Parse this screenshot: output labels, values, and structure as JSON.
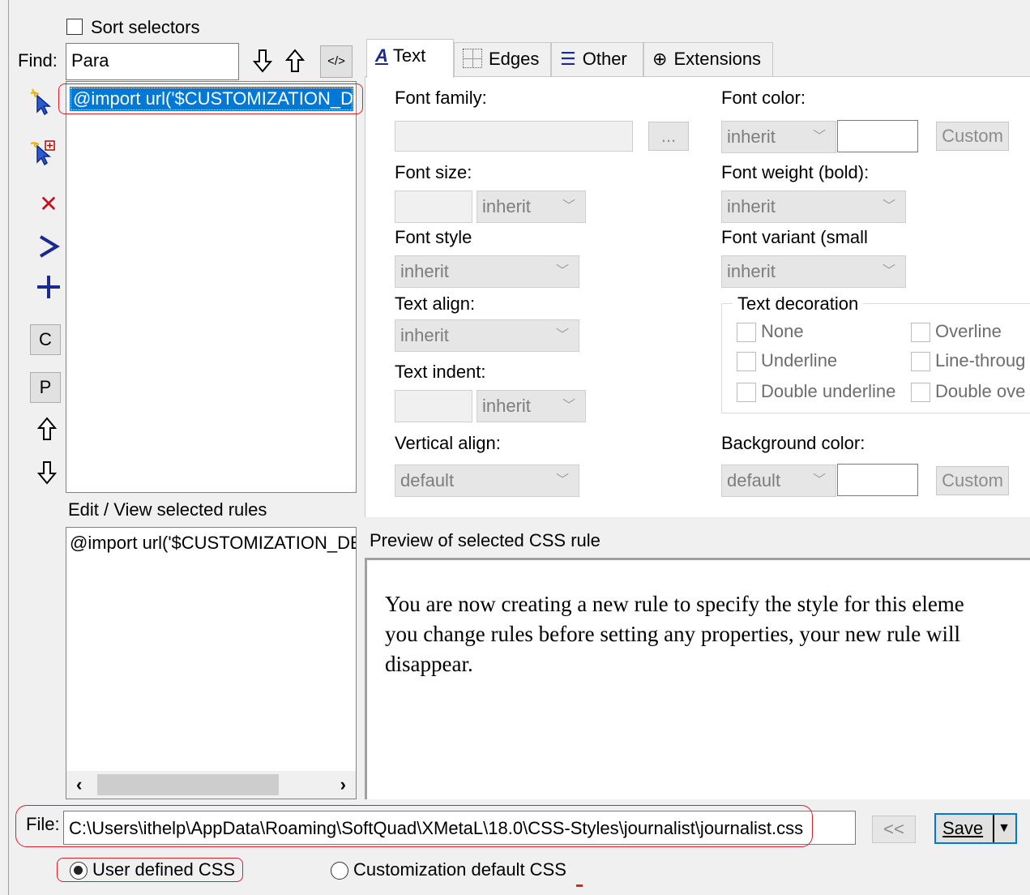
{
  "sort": {
    "label": "Sort selectors"
  },
  "find": {
    "label": "Find:",
    "value": "Para",
    "down_icon": "arrow-down-icon",
    "up_icon": "arrow-up-icon",
    "code_label": "</>"
  },
  "selectors": {
    "items": [
      "@import url('$CUSTOMIZATION_DE"
    ]
  },
  "toolbar": {
    "c_label": "C",
    "p_label": "P"
  },
  "tabs": [
    {
      "label": "Text",
      "icon": "font-icon"
    },
    {
      "label": "Edges",
      "icon": "grid-icon"
    },
    {
      "label": "Other",
      "icon": "list-icon"
    },
    {
      "label": "Extensions",
      "icon": "plus-circle-icon"
    }
  ],
  "text_tab": {
    "font_family": {
      "label": "Font family:",
      "browse": "..."
    },
    "font_color": {
      "label": "Font color:",
      "value": "inherit",
      "custom": "Custom"
    },
    "font_size": {
      "label": "Font size:",
      "unit": "inherit"
    },
    "font_weight": {
      "label": "Font weight (bold):",
      "value": "inherit"
    },
    "font_style": {
      "label": "Font style",
      "value": "inherit"
    },
    "font_variant": {
      "label": "Font variant (small",
      "value": "inherit"
    },
    "text_align": {
      "label": "Text align:",
      "value": "inherit"
    },
    "text_decoration": {
      "label": "Text decoration",
      "options": [
        "None",
        "Overline",
        "Underline",
        "Line-throug",
        "Double underline",
        "Double ove"
      ]
    },
    "text_indent": {
      "label": "Text indent:",
      "unit": "inherit"
    },
    "vertical_align": {
      "label": "Vertical align:",
      "value": "default"
    },
    "background_color": {
      "label": "Background color:",
      "value": "default",
      "custom": "Custom"
    }
  },
  "edit": {
    "label": "Edit / View selected rules",
    "content": "@import url('$CUSTOMIZATION_DE"
  },
  "preview": {
    "label": "Preview of selected CSS rule",
    "lines": [
      "You are now creating a new rule to specify the style for this eleme",
      "you change rules before setting any properties, your new rule will",
      "disappear."
    ]
  },
  "file": {
    "label": "File:",
    "path": "C:\\Users\\ithelp\\AppData\\Roaming\\SoftQuad\\XMetaL\\18.0\\CSS-Styles\\journalist\\journalist.css",
    "prev": "<<",
    "save": "Save"
  },
  "css_mode": {
    "user": "User defined CSS",
    "custom": "Customization default CSS",
    "selected": "user"
  },
  "colors": {
    "selection": "#0078d7",
    "annotation": "#e0202a"
  }
}
